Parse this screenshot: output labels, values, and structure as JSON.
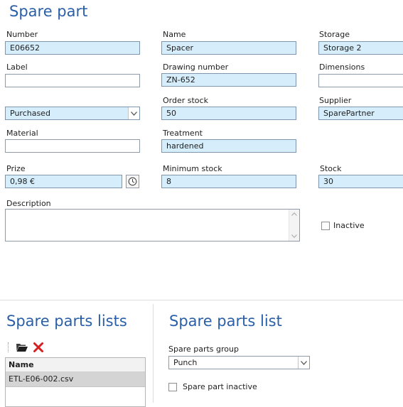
{
  "spare_part": {
    "title": "Spare part",
    "number": {
      "label": "Number",
      "value": "E06652"
    },
    "name": {
      "label": "Name",
      "value": "Spacer"
    },
    "storage": {
      "label": "Storage",
      "value": "Storage 2"
    },
    "part_label": {
      "label": "Label",
      "value": ""
    },
    "drawing_number": {
      "label": "Drawing number",
      "value": "ZN-652"
    },
    "dimensions": {
      "label": "Dimensions",
      "value": ""
    },
    "procurement": {
      "value": "Purchased"
    },
    "order_stock": {
      "label": "Order stock",
      "value": "50"
    },
    "supplier": {
      "label": "Supplier",
      "value": "SparePartner"
    },
    "material": {
      "label": "Material",
      "value": ""
    },
    "treatment": {
      "label": "Treatment",
      "value": "hardened"
    },
    "prize": {
      "label": "Prize",
      "value": "0,98 €"
    },
    "minimum_stock": {
      "label": "Minimum stock",
      "value": "8"
    },
    "stock": {
      "label": "Stock",
      "value": "30"
    },
    "description": {
      "label": "Description",
      "value": ""
    },
    "inactive": {
      "label": "Inactive",
      "checked": false
    }
  },
  "spare_parts_lists": {
    "title": "Spare parts lists",
    "toolbar": {
      "open_icon": "folder-open-icon",
      "delete_icon": "delete-x-icon"
    },
    "table": {
      "columns": [
        "Name"
      ],
      "rows": [
        {
          "name": "ETL-E06-002.csv"
        }
      ]
    }
  },
  "spare_parts_list": {
    "title": "Spare parts list",
    "group": {
      "label": "Spare parts group",
      "value": "Punch"
    },
    "inactive": {
      "label": "Spare part inactive",
      "checked": false
    }
  },
  "colors": {
    "accent": "#2a5fa8",
    "field_filled": "#d6eefb",
    "field_border": "#8e9aa8",
    "delete_red": "#d42020"
  }
}
